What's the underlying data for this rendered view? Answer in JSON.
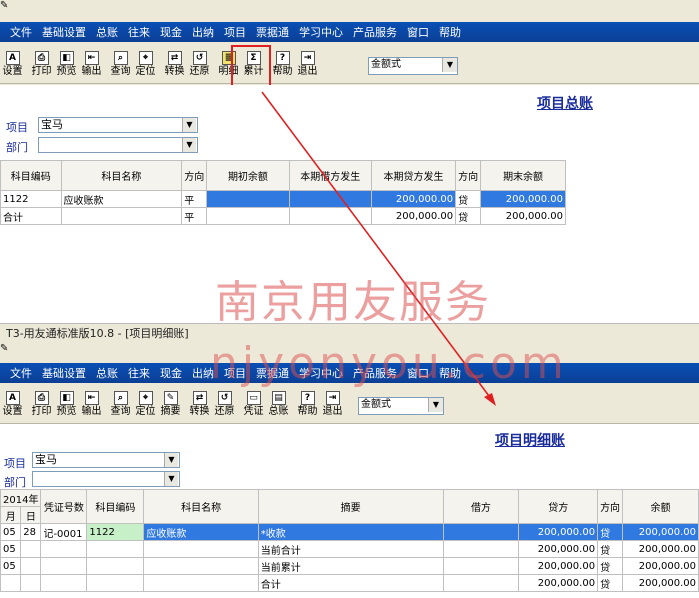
{
  "menu": [
    "文件",
    "基础设置",
    "总账",
    "往来",
    "现金",
    "出纳",
    "项目",
    "票据通",
    "学习中心",
    "产品服务",
    "窗口",
    "帮助"
  ],
  "toolbar1": [
    "设置",
    "打印",
    "预览",
    "输出",
    "查询",
    "定位",
    "转换",
    "还原",
    "明细",
    "累计",
    "帮助",
    "退出"
  ],
  "toolbar2": [
    "设置",
    "打印",
    "预览",
    "输出",
    "查询",
    "定位",
    "摘要",
    "转换",
    "还原",
    "凭证",
    "总账",
    "帮助",
    "退出"
  ],
  "format_select": "金额式",
  "window2_title": "T3-用友通标准版10.8 - [项目明细账]",
  "top": {
    "title": "项目总账",
    "project_label": "项目",
    "project_value": "宝马",
    "dept_label": "部门",
    "headers": [
      "科目编码",
      "科目名称",
      "方向",
      "期初余额",
      "本期借方发生",
      "本期贷方发生",
      "方向",
      "期末余额"
    ],
    "rows": [
      [
        "1122",
        "应收账款",
        "平",
        "",
        "",
        "200,000.00",
        "贷",
        "200,000.00"
      ],
      [
        "合计",
        "",
        "平",
        "",
        "",
        "200,000.00",
        "贷",
        "200,000.00"
      ]
    ]
  },
  "bottom": {
    "title": "项目明细账",
    "project_label": "项目",
    "project_value": "宝马",
    "dept_label": "部门",
    "year": "2014年",
    "month_label": "月",
    "day_label": "日",
    "headers": [
      "凭证号数",
      "科目编码",
      "科目名称",
      "摘要",
      "借方",
      "贷方",
      "方向",
      "余额"
    ],
    "rows": [
      [
        "05",
        "28",
        "记-0001",
        "1122",
        "应收账款",
        "*收款",
        "",
        "200,000.00",
        "贷",
        "200,000.00"
      ],
      [
        "05",
        "",
        "",
        "",
        "",
        "当前合计",
        "",
        "200,000.00",
        "贷",
        "200,000.00"
      ],
      [
        "05",
        "",
        "",
        "",
        "",
        "当前累计",
        "",
        "200,000.00",
        "贷",
        "200,000.00"
      ],
      [
        "",
        "",
        "",
        "",
        "",
        "合计",
        "",
        "200,000.00",
        "贷",
        "200,000.00"
      ]
    ]
  },
  "watermark": {
    "cn": "南京用友服务",
    "en": "njyonyou.com"
  }
}
